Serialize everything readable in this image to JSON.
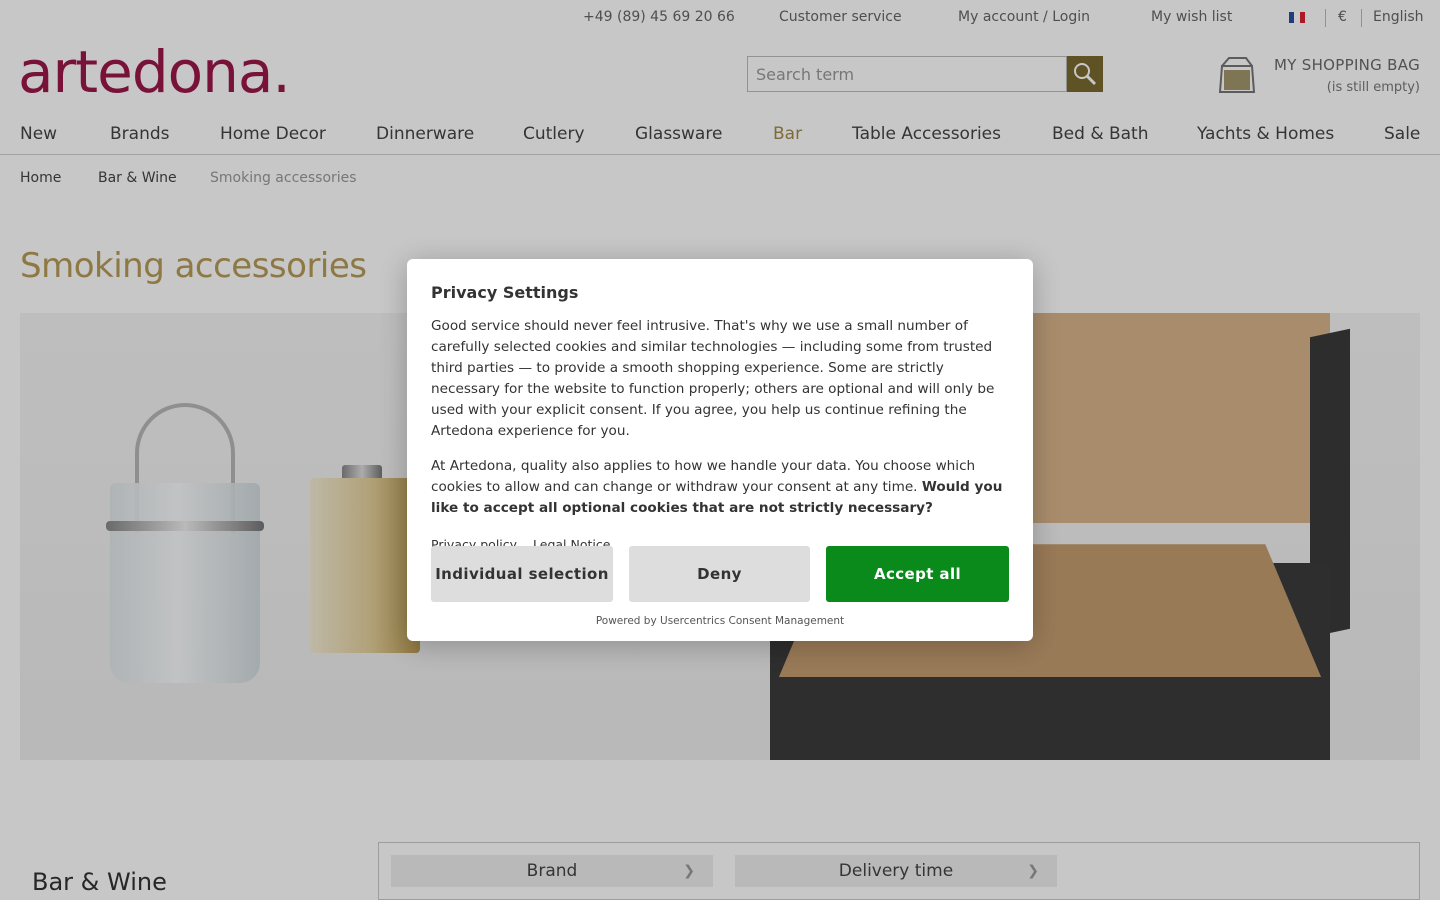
{
  "topbar": {
    "phone": "+49 (89) 45 69 20 66",
    "customer_service": "Customer service",
    "account": "My account / Login",
    "wishlist": "My wish list",
    "currency": "€",
    "language": "English"
  },
  "logo": "artedona.",
  "search": {
    "placeholder": "Search term"
  },
  "bag": {
    "title": "MY SHOPPING BAG",
    "subtitle": "(is still empty)"
  },
  "nav": [
    "New",
    "Brands",
    "Home Decor",
    "Dinnerware",
    "Cutlery",
    "Glassware",
    "Bar",
    "Table Accessories",
    "Bed & Bath",
    "Yachts & Homes",
    "Sale"
  ],
  "breadcrumb": [
    "Home",
    "Bar & Wine",
    "Smoking accessories"
  ],
  "page_title": "Smoking accessories",
  "sidebar": {
    "heading": "Bar & Wine"
  },
  "filters": [
    "Brand",
    "Delivery time"
  ],
  "consent": {
    "title": "Privacy Settings",
    "para1": "Good service should never feel intrusive. That's why we use a small number of carefully selected cookies and similar technologies — including some from trusted third parties — to provide a smooth shopping experience. Some are strictly necessary for the website to function properly; others are optional and will only be used with your explicit consent. If you agree, you help us continue refining the Artedona experience for you.",
    "para2": "At Artedona, quality also applies to how we handle your data. You choose which cookies to allow and can change or withdraw your consent at any time.",
    "para2_bold": "Would you like to accept all optional cookies that are not strictly necessary?",
    "privacy_link": "Privacy policy",
    "legal_link": "Legal Notice",
    "btn_individual": "Individual selection",
    "btn_deny": "Deny",
    "btn_accept": "Accept all",
    "powered": "Powered by Usercentrics Consent Management"
  },
  "colors": {
    "brand": "#9b1848",
    "gold": "#b79a58",
    "accept": "#0a8a1b"
  }
}
